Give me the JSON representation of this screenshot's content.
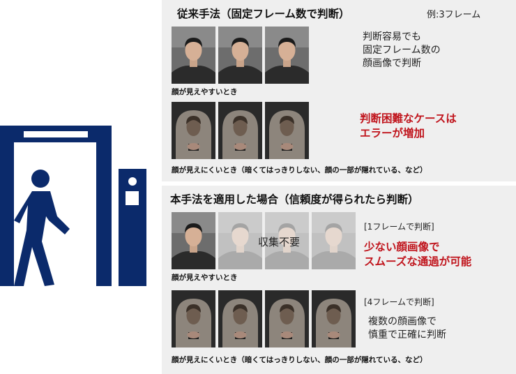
{
  "conventional": {
    "title": "従来手法（固定フレーム数で判断）",
    "example": "例:3フレーム",
    "note_lines": [
      "判断容易でも",
      "固定フレーム数の",
      "顔画像で判断"
    ],
    "easy_caption": "顔が見えやすいとき",
    "red_lines": [
      "判断困難なケースは",
      "エラーが増加"
    ],
    "hard_caption": "顔が見えにくいとき（暗くてはっきりしない、顔の一部が隠れている、など）"
  },
  "proposed": {
    "title": "本手法を適用した場合（信頼度が得られたら判断）",
    "easy_bracket": "[1フレームで判断]",
    "overlay": "収集不要",
    "red_lines": [
      "少ない顔画像で",
      "スムーズな通過が可能"
    ],
    "easy_caption": "顔が見えやすいとき",
    "hard_bracket": "[4フレームで判断]",
    "note_lines": [
      "複数の顔画像で",
      "慎重で正確に判断"
    ],
    "hard_caption": "顔が見えにくいとき（暗くてはっきりしない、顔の一部が隠れている、など）"
  },
  "colors": {
    "navy": "#0b2a6b",
    "red": "#c0141c",
    "panel": "#efefef"
  },
  "icons": [
    "walk-through-gate-icon",
    "camera-pole-icon",
    "walking-person-icon"
  ]
}
